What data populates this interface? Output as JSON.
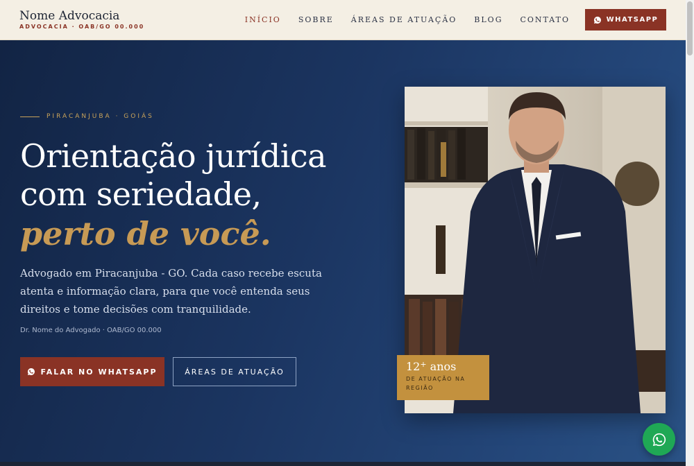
{
  "header": {
    "brand_name": "Nome Advocacia",
    "brand_sub": "ADVOCACIA · OAB/GO 00.000",
    "nav": [
      {
        "label": "INÍCIO",
        "active": true
      },
      {
        "label": "SOBRE"
      },
      {
        "label": "ÁREAS DE ATUAÇÃO"
      },
      {
        "label": "BLOG"
      },
      {
        "label": "CONTATO"
      }
    ],
    "cta_label": "WHATSAPP"
  },
  "hero": {
    "eyebrow": "PIRACANJUBA · GOIÁS",
    "headline_line1": "Orientação jurídica",
    "headline_line2": "com seriedade,",
    "headline_accent": "perto de você.",
    "lead": "Advogado em Piracanjuba - GO. Cada caso recebe escuta atenta e informação clara, para que você entenda seus direitos e tome decisões com tranquilidade.",
    "credential": "Dr. Nome do Advogado · OAB/GO 00.000",
    "primary_button": "FALAR NO WHATSAPP",
    "secondary_button": "ÁREAS DE ATUAÇÃO",
    "badge_number": "12",
    "badge_plus": "+",
    "badge_unit": "anos",
    "badge_text": "DE ATUAÇÃO NA REGIÃO"
  },
  "colors": {
    "header_bg": "#f4efe4",
    "brand_accent": "#8a3325",
    "hero_bg": "#1b3561",
    "gold": "#c79a55",
    "whatsapp_green": "#1fa855"
  },
  "icons": {
    "whatsapp": "whatsapp-icon"
  }
}
